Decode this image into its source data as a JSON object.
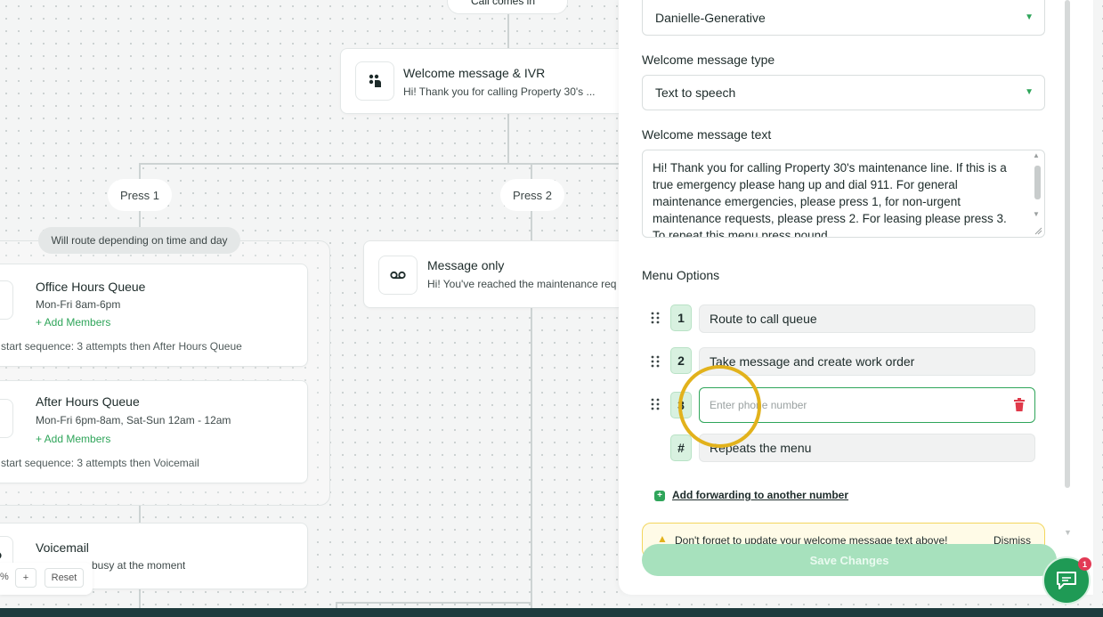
{
  "canvas": {
    "top_chip": "Call comes in",
    "welcome_node": {
      "title": "Welcome message & IVR",
      "subtitle": "Hi! Thank you for calling Property 30's ..."
    },
    "branch_labels": [
      "Press 1",
      "Press 2"
    ],
    "route_pill": "Will route depending on time and day",
    "office_queue": {
      "title": "Office Hours Queue",
      "hours": "Mon-Fri 8am-6pm",
      "add_members": "+ Add Members",
      "sequence": "start sequence: 3 attempts then After Hours Queue"
    },
    "after_hours_queue": {
      "title": "After Hours Queue",
      "hours": "Mon-Fri 6pm-8am, Sat-Sun 12am - 12am",
      "add_members": "+ Add Members",
      "sequence": "start sequence: 3 attempts then Voicemail"
    },
    "voicemail": {
      "title": "Voicemail",
      "subtitle": "busy at the moment"
    },
    "message_only": {
      "title": "Message only",
      "subtitle": "Hi! You've reached the maintenance req"
    },
    "zoom": {
      "percent": "%",
      "plus": "+",
      "reset": "Reset"
    }
  },
  "panel": {
    "voice_select": "Danielle-Generative",
    "welcome_type_label": "Welcome message type",
    "welcome_type_value": "Text to speech",
    "welcome_text_label": "Welcome message text",
    "welcome_text_value": "Hi! Thank you for calling Property 30's maintenance line. If this is a true emergency please hang up and dial 911. For general maintenance emergencies, please press 1, for non-urgent maintenance requests, please press 2. For leasing please press 3. To repeat this menu press pound.",
    "menu_options_label": "Menu Options",
    "menu_options": [
      {
        "key": "1",
        "value": "Route to call queue"
      },
      {
        "key": "2",
        "value": "Take message and create work order"
      },
      {
        "key": "3",
        "placeholder": "Enter phone number"
      },
      {
        "key": "#",
        "value": "Repeats the menu"
      }
    ],
    "add_forwarding": "Add forwarding to another number",
    "warning_text": "Don't forget to update your welcome message text above!",
    "warning_dismiss": "Dismiss",
    "save_button": "Save Changes"
  },
  "chat": {
    "badge_count": "1"
  },
  "colors": {
    "accent_green": "#2fa55a",
    "highlight_ring": "#e2b21c",
    "save_disabled": "#a7e1bd",
    "badge_red": "#e23a55"
  }
}
